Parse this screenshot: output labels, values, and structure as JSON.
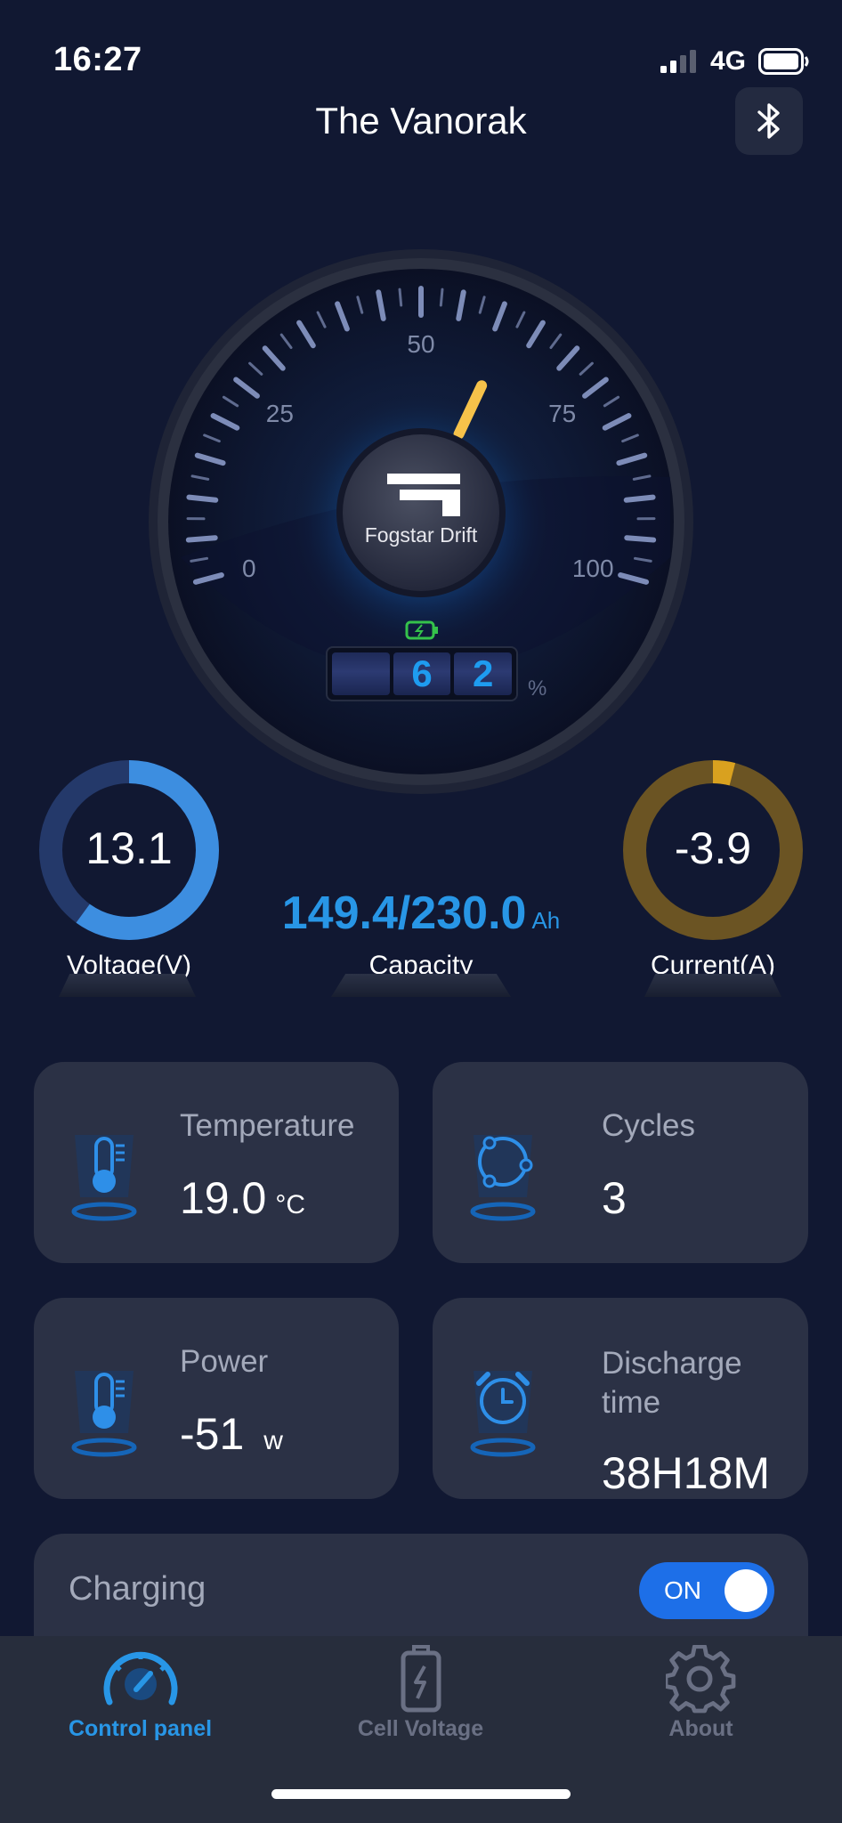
{
  "status_bar": {
    "time": "16:27",
    "network": "4G"
  },
  "header": {
    "title": "The Vanorak",
    "bluetooth_icon": "bluetooth-icon"
  },
  "gauge": {
    "tick_labels": [
      "0",
      "25",
      "50",
      "75",
      "100"
    ],
    "needle_value": 62,
    "brand": "Fogstar Drift",
    "soc_digits": [
      "",
      "6",
      "2"
    ],
    "soc_unit": "%",
    "battery_icon": "battery-charging-icon"
  },
  "voltage": {
    "value": "13.1",
    "label": "Voltage(V)",
    "ring_fraction": 0.6,
    "color": "#3d8ee0"
  },
  "capacity": {
    "value": "149.4/230.0",
    "unit": "Ah",
    "label": "Capacity"
  },
  "current": {
    "value": "-3.9",
    "label": "Current(A)",
    "ring_fraction": 0.04,
    "color": "#d9a11f"
  },
  "cards": {
    "temperature": {
      "title": "Temperature",
      "value": "19.0",
      "unit": "°C",
      "icon": "thermometer-icon"
    },
    "cycles": {
      "title": "Cycles",
      "value": "3",
      "icon": "cycle-icon"
    },
    "power": {
      "title": "Power",
      "value": "-51",
      "unit": "w",
      "icon": "thermometer-icon"
    },
    "discharge": {
      "title": "Discharge time",
      "value": "38H18M",
      "icon": "alarm-clock-icon"
    }
  },
  "charging": {
    "label": "Charging",
    "toggle": "ON"
  },
  "nav": [
    {
      "label": "Control panel",
      "icon": "speedometer-icon",
      "active": true
    },
    {
      "label": "Cell Voltage",
      "icon": "battery-icon",
      "active": false
    },
    {
      "label": "About",
      "icon": "gear-icon",
      "active": false
    }
  ],
  "colors": {
    "accent": "#2896e6",
    "background": "#111832",
    "card": "#2b3145"
  }
}
